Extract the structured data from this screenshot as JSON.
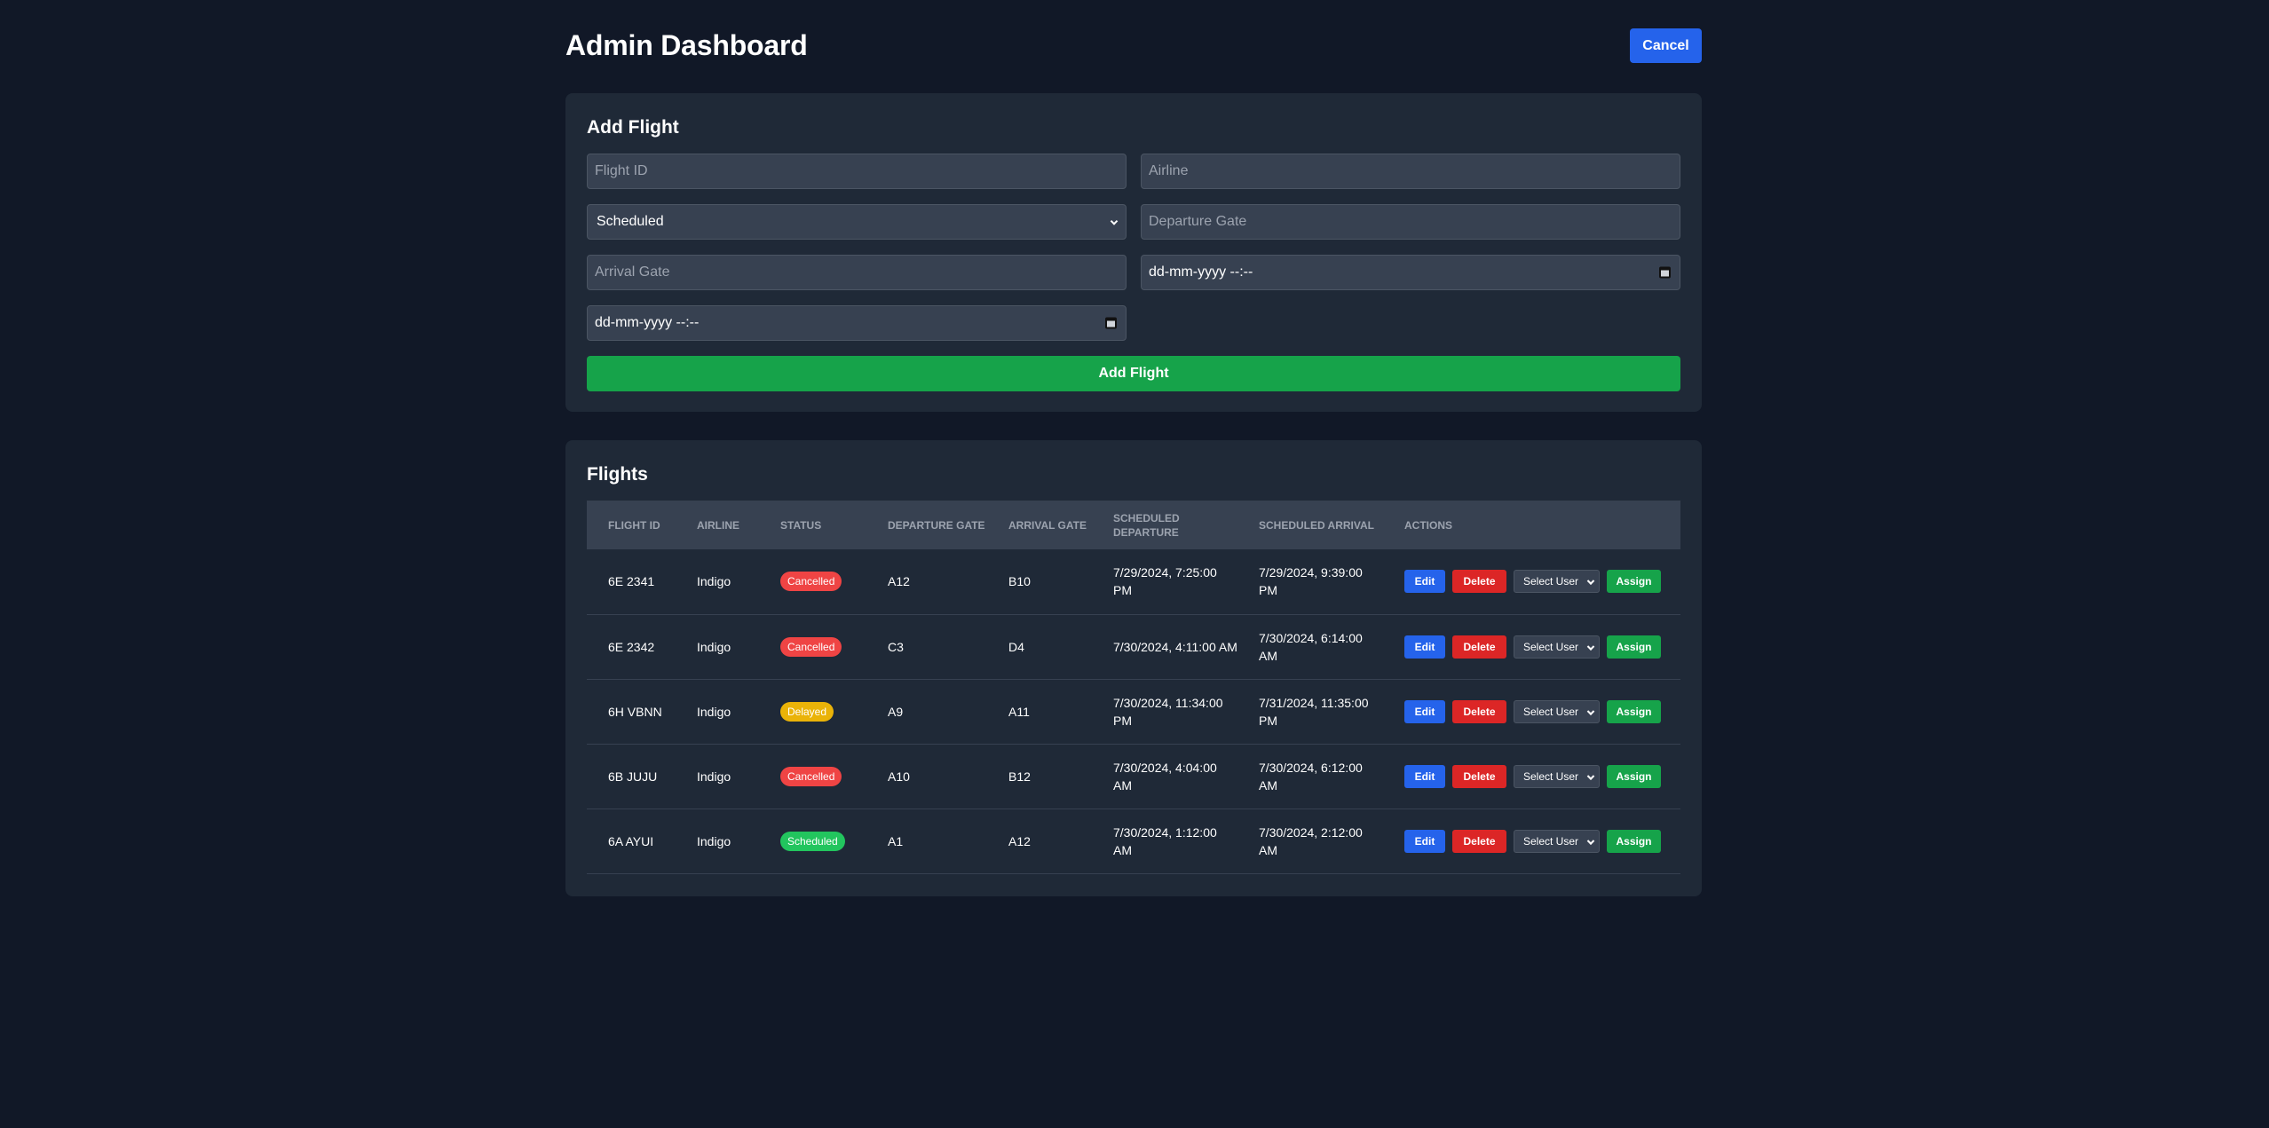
{
  "header": {
    "title": "Admin Dashboard",
    "cancel_label": "Cancel"
  },
  "add_flight": {
    "title": "Add Flight",
    "flight_id_placeholder": "Flight ID",
    "airline_placeholder": "Airline",
    "status_value": "Scheduled",
    "departure_gate_placeholder": "Departure Gate",
    "arrival_gate_placeholder": "Arrival Gate",
    "scheduled_departure_placeholder": "dd-mm-yyyy --:--",
    "scheduled_arrival_placeholder": "dd-mm-yyyy --:--",
    "submit_label": "Add Flight"
  },
  "flights": {
    "title": "Flights",
    "columns": [
      "FLIGHT ID",
      "AIRLINE",
      "STATUS",
      "DEPARTURE GATE",
      "ARRIVAL GATE",
      "SCHEDULED DEPARTURE",
      "SCHEDULED ARRIVAL",
      "ACTIONS"
    ],
    "action_labels": {
      "edit": "Edit",
      "delete": "Delete",
      "select_user": "Select User",
      "assign": "Assign"
    },
    "rows": [
      {
        "flight_id": "6E 2341",
        "airline": "Indigo",
        "status": "Cancelled",
        "departure_gate": "A12",
        "arrival_gate": "B10",
        "scheduled_departure": "7/29/2024, 7:25:00 PM",
        "scheduled_arrival": "7/29/2024, 9:39:00 PM"
      },
      {
        "flight_id": "6E 2342",
        "airline": "Indigo",
        "status": "Cancelled",
        "departure_gate": "C3",
        "arrival_gate": "D4",
        "scheduled_departure": "7/30/2024, 4:11:00 AM",
        "scheduled_arrival": "7/30/2024, 6:14:00 AM"
      },
      {
        "flight_id": "6H VBNN",
        "airline": "Indigo",
        "status": "Delayed",
        "departure_gate": "A9",
        "arrival_gate": "A11",
        "scheduled_departure": "7/30/2024, 11:34:00 PM",
        "scheduled_arrival": "7/31/2024, 11:35:00 PM"
      },
      {
        "flight_id": "6B JUJU",
        "airline": "Indigo",
        "status": "Cancelled",
        "departure_gate": "A10",
        "arrival_gate": "B12",
        "scheduled_departure": "7/30/2024, 4:04:00 AM",
        "scheduled_arrival": "7/30/2024, 6:12:00 AM"
      },
      {
        "flight_id": "6A AYUI",
        "airline": "Indigo",
        "status": "Scheduled",
        "departure_gate": "A1",
        "arrival_gate": "A12",
        "scheduled_departure": "7/30/2024, 1:12:00 AM",
        "scheduled_arrival": "7/30/2024, 2:12:00 AM"
      }
    ]
  },
  "colors": {
    "background": "#111827",
    "card": "#1f2937",
    "input": "#374151",
    "primary": "#2563eb",
    "danger": "#dc2626",
    "success": "#16a34a",
    "status_cancelled": "#ef4444",
    "status_delayed": "#eab308",
    "status_scheduled": "#22c55e"
  }
}
